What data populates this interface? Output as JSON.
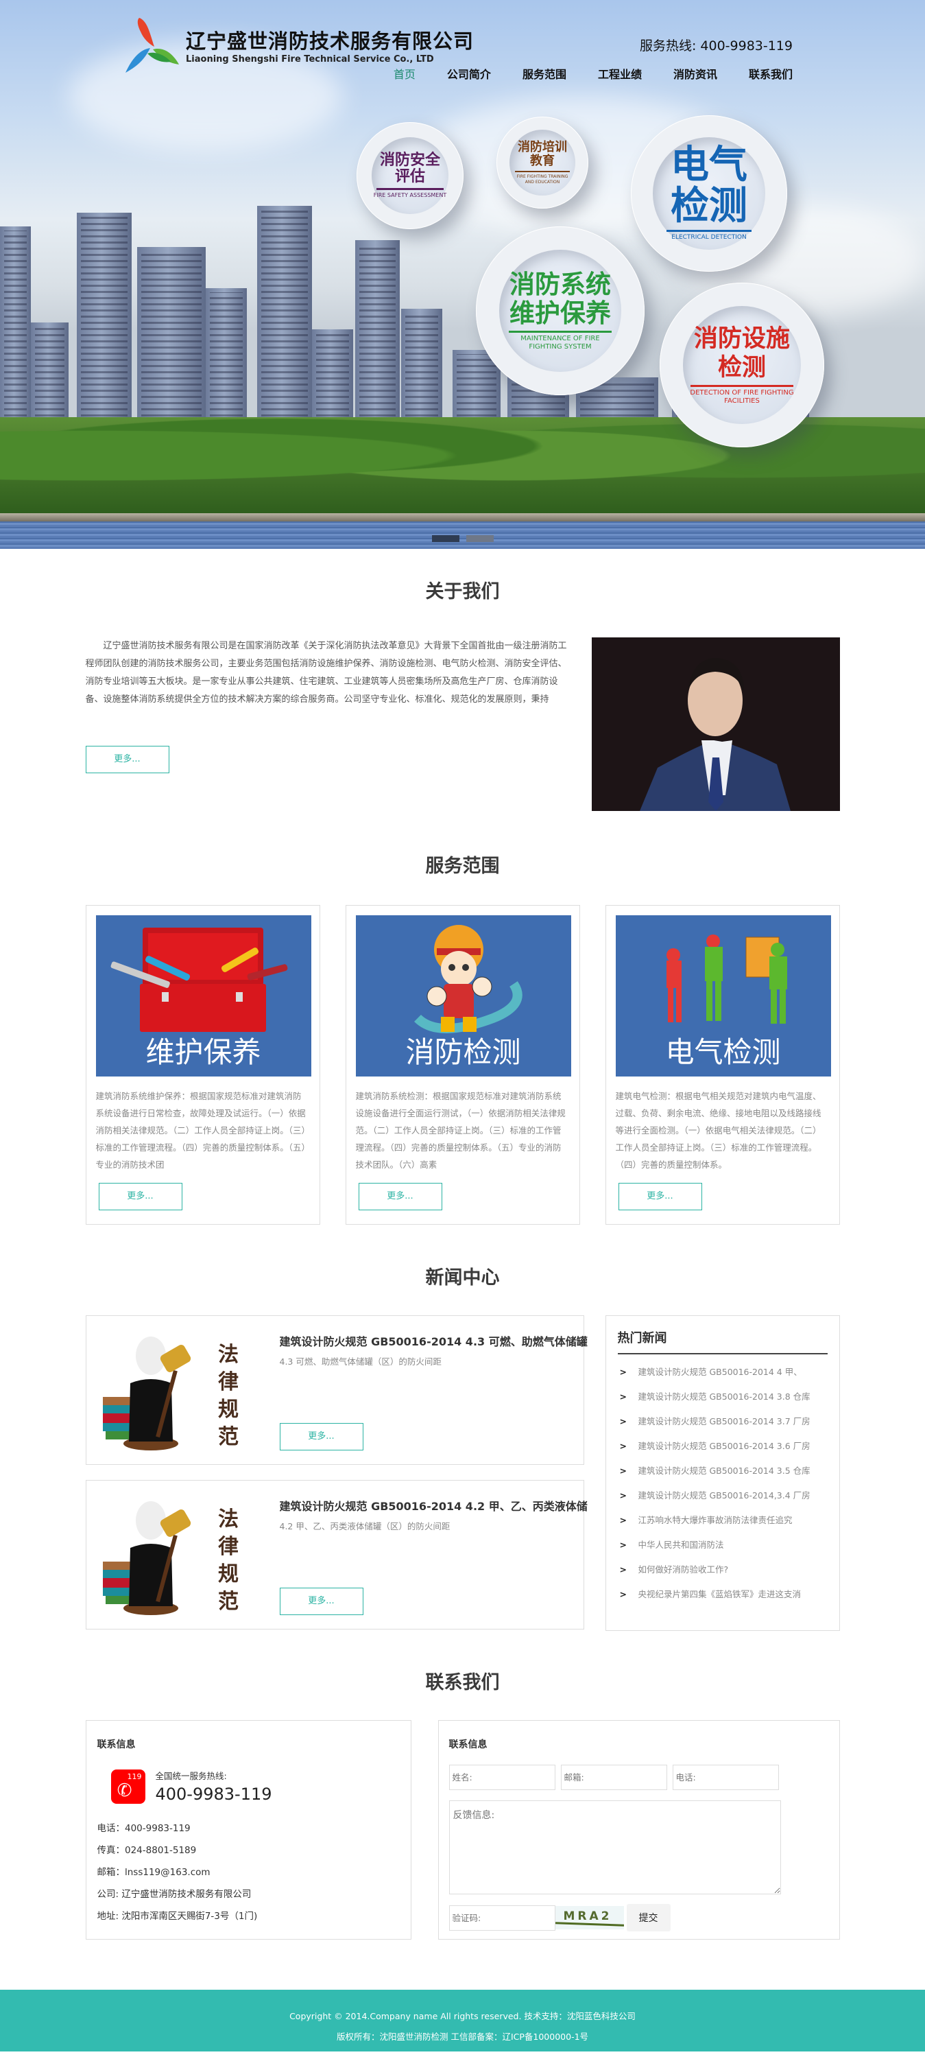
{
  "header": {
    "logo_cn": "辽宁盛世消防技术服务有限公司",
    "logo_en": "Liaoning Shengshi Fire Technical Service Co., LTD",
    "hotline_label": "服务热线:",
    "hotline_number": "400-9983-119",
    "nav": [
      {
        "label": "首页",
        "active": true
      },
      {
        "label": "公司简介",
        "active": false
      },
      {
        "label": "服务范围",
        "active": false
      },
      {
        "label": "工程业绩",
        "active": false
      },
      {
        "label": "消防资讯",
        "active": false
      },
      {
        "label": "联系我们",
        "active": false
      }
    ]
  },
  "hero": {
    "circles": [
      {
        "cn1": "消防安全",
        "cn2": "评估",
        "en": "FIRE SAFETY ASSESSMENT",
        "color": "#5a1e5e"
      },
      {
        "cn1": "消防培训",
        "cn2": "教育",
        "en": "FIRE FIGHTING TRAINING AND EDUCATION",
        "color": "#7a4117"
      },
      {
        "cn1": "电气",
        "cn2": "检测",
        "en": "ELECTRICAL DETECTION",
        "color": "#1565b4"
      },
      {
        "cn1": "消防系统",
        "cn2": "维护保养",
        "en": "MAINTENANCE OF FIRE FIGHTING SYSTEM",
        "color": "#2a9a3e"
      },
      {
        "cn1": "消防设施",
        "cn2": "检测",
        "en": "DETECTION OF FIRE FIGHTING FACILITIES",
        "color": "#d42a23"
      }
    ],
    "slide_count": 2,
    "active_slide": 1
  },
  "about": {
    "title": "关于我们",
    "text": "辽宁盛世消防技术服务有限公司是在国家消防改革《关于深化消防执法改革意见》大背景下全国首批由一级注册消防工程师团队创建的消防技术服务公司，主要业务范围包括消防设施维护保养、消防设施检测、电气防火检测、消防安全评估、消防专业培训等五大板块。是一家专业从事公共建筑、住宅建筑、工业建筑等人员密集场所及高危生产厂房、仓库消防设备、设施整体消防系统提供全方位的技术解决方案的综合服务商。公司坚守专业化、标准化、规范化的发展原则，秉持",
    "more": "更多..."
  },
  "services": {
    "title": "服务范围",
    "items": [
      {
        "label": "维护保养",
        "desc": "建筑消防系统维护保养：根据国家规范标准对建筑消防系统设备进行日常检查，故障处理及试运行。（一）依据消防相关法律规范。（二）工作人员全部持证上岗。（三）标准的工作管理流程。（四）完善的质量控制体系。（五）专业的消防技术团",
        "more": "更多..."
      },
      {
        "label": "消防检测",
        "desc": "建筑消防系统检测：根据国家规范标准对建筑消防系统设施设备进行全面运行测试，（一）依据消防相关法律规范。（二）工作人员全部持证上岗。（三）标准的工作管理流程。（四）完善的质量控制体系。（五）专业的消防技术团队。（六）高素",
        "more": "更多..."
      },
      {
        "label": "电气检测",
        "desc": "建筑电气检测：根据电气相关规范对建筑内电气温度、过载、负荷、剩余电流、绝缘、接地电阻以及线路接线等进行全面检测。（一）依据电气相关法律规范。（二）工作人员全部持证上岗。（三）标准的工作管理流程。（四）完善的质量控制体系。",
        "more": "更多..."
      }
    ]
  },
  "news": {
    "title": "新闻中心",
    "thumb_text": "法律规范",
    "items": [
      {
        "title": "建筑设计防火规范 GB50016-2014 4.3 可燃、助燃气体储罐",
        "sub": "4.3 可燃、助燃气体储罐（区）的防火间距",
        "more": "更多..."
      },
      {
        "title": "建筑设计防火规范 GB50016-2014 4.2 甲、乙、丙类液体储",
        "sub": "4.2 甲、乙、丙类液体储罐（区）的防火间距",
        "more": "更多..."
      }
    ],
    "hot_title": "热门新闻",
    "hot": [
      "建筑设计防火规范 GB50016-2014 4 甲、",
      "建筑设计防火规范 GB50016-2014 3.8 仓库",
      "建筑设计防火规范 GB50016-2014 3.7 厂房",
      "建筑设计防火规范 GB50016-2014 3.6 厂房",
      "建筑设计防火规范 GB50016-2014 3.5 仓库",
      "建筑设计防火规范 GB50016-2014,3.4 厂房",
      "江苏响水特大爆炸事故消防法律责任追究",
      "中华人民共和国消防法",
      "如何做好消防验收工作?",
      "央视纪录片第四集《蓝焰铁军》走进这支消"
    ]
  },
  "contact": {
    "title": "联系我们",
    "info_heading": "联系信息",
    "hotline_label": "全国统一服务热线:",
    "hotline_number": "400-9983-119",
    "icon_text": "119",
    "lines": [
      "电话：400-9983-119",
      "传真：024-8801-5189",
      "邮箱：lnss119@163.com",
      "公司: 辽宁盛世消防技术服务有限公司",
      "地址: 沈阳市浑南区天赐街7-3号（1门)"
    ],
    "form_heading": "联系信息",
    "name_placeholder": "姓名:",
    "email_placeholder": "邮箱:",
    "phone_placeholder": "电话:",
    "message_placeholder": "反馈信息:",
    "captcha_placeholder": "验证码:",
    "captcha_text": "MRA2",
    "submit": "提交"
  },
  "footer": {
    "line1": "Copyright © 2014.Company name All rights reserved. 技术支持：沈阳蓝色科技公司",
    "line2": "版权所有：沈阳盛世消防检测 工信部备案：辽ICP备1000000-1号"
  }
}
